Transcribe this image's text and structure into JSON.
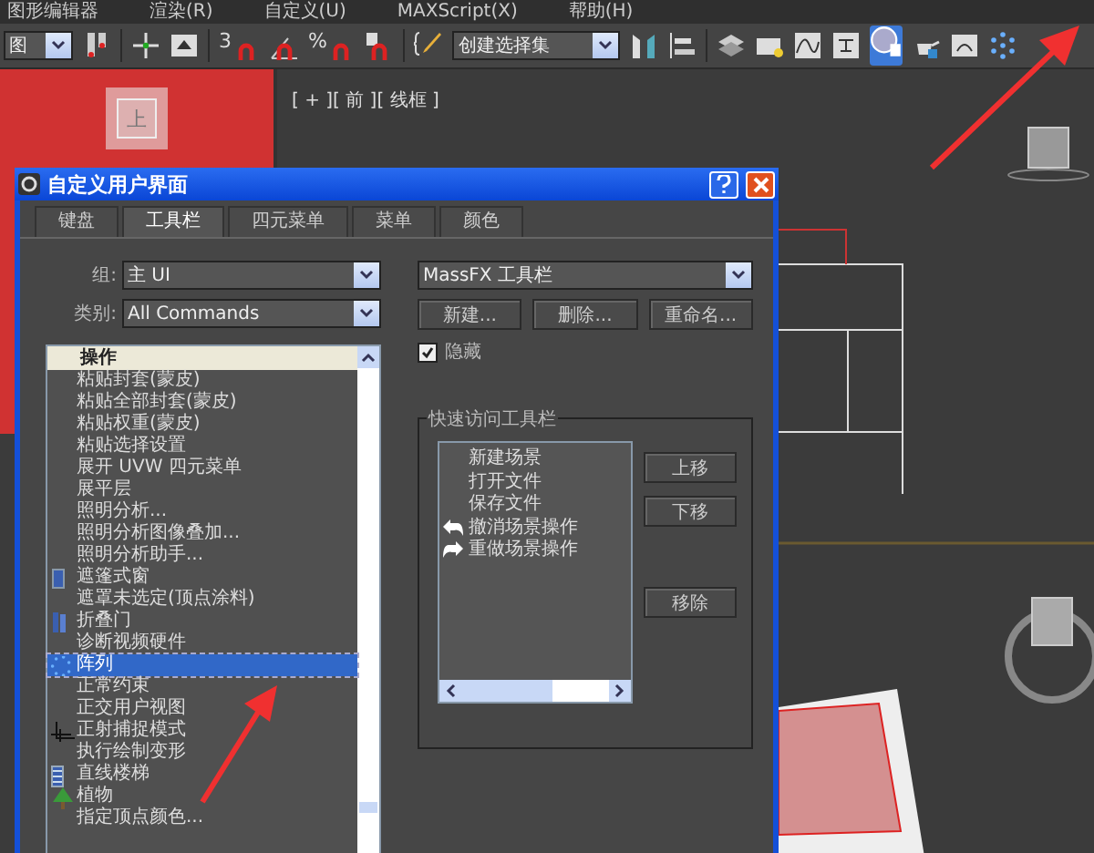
{
  "menu_bar": [
    "图形编辑器",
    "渲染(R)",
    "自定义(U)",
    "MAXScript(X)",
    "帮助(H)"
  ],
  "toolbar": {
    "layout_dropdown": "图",
    "snap_labels": [
      "3",
      "%"
    ],
    "selection_set_dropdown": "创建选择集"
  },
  "viewports": {
    "top_left_cube_label": "上",
    "front_label": "[ + ][ 前 ][ 线框 ]"
  },
  "dialog": {
    "title": "自定义用户界面",
    "tabs": [
      {
        "label": "键盘",
        "selected": false
      },
      {
        "label": "工具栏",
        "selected": true
      },
      {
        "label": "四元菜单",
        "selected": false
      },
      {
        "label": "菜单",
        "selected": false
      },
      {
        "label": "颜色",
        "selected": false
      }
    ],
    "group_label": "组:",
    "group_value": "主 UI",
    "category_label": "类别:",
    "category_value": "All Commands",
    "actions_header": "操作",
    "actions": [
      {
        "label": "粘贴封套(蒙皮)",
        "kind": "plain",
        "selected": false
      },
      {
        "label": "粘贴全部封套(蒙皮)",
        "kind": "plain",
        "selected": false
      },
      {
        "label": "粘贴权重(蒙皮)",
        "kind": "plain",
        "selected": false
      },
      {
        "label": "粘贴选择设置",
        "kind": "plain",
        "selected": false
      },
      {
        "label": "展开 UVW 四元菜单",
        "kind": "plain",
        "selected": false
      },
      {
        "label": "展平层",
        "kind": "plain",
        "selected": false
      },
      {
        "label": "照明分析...",
        "kind": "plain",
        "selected": false
      },
      {
        "label": "照明分析图像叠加...",
        "kind": "plain",
        "selected": false
      },
      {
        "label": "照明分析助手...",
        "kind": "plain",
        "selected": false
      },
      {
        "label": "遮篷式窗",
        "kind": "window",
        "selected": false
      },
      {
        "label": "遮罩未选定(顶点涂料)",
        "kind": "plain",
        "selected": false
      },
      {
        "label": "折叠门",
        "kind": "door",
        "selected": false
      },
      {
        "label": "诊断视频硬件",
        "kind": "plain",
        "selected": false
      },
      {
        "label": "阵列",
        "kind": "array",
        "selected": true
      },
      {
        "label": "正常约束",
        "kind": "plain",
        "selected": false
      },
      {
        "label": "正交用户视图",
        "kind": "plain",
        "selected": false
      },
      {
        "label": "正射捕捉模式",
        "kind": "snap",
        "selected": false
      },
      {
        "label": "执行绘制变形",
        "kind": "plain",
        "selected": false
      },
      {
        "label": "直线楼梯",
        "kind": "stairs",
        "selected": false
      },
      {
        "label": "植物",
        "kind": "plant",
        "selected": false
      },
      {
        "label": "指定顶点颜色...",
        "kind": "plain",
        "selected": false
      }
    ],
    "toolbar_value": "MassFX 工具栏",
    "toolbar_buttons": [
      "新建...",
      "删除...",
      "重命名..."
    ],
    "hide": {
      "label": "隐藏",
      "checked": true
    },
    "quick_access": {
      "title": "快速访问工具栏",
      "items": [
        {
          "label": "新建场景",
          "kind": "plain"
        },
        {
          "label": "打开文件",
          "kind": "plain"
        },
        {
          "label": "保存文件",
          "kind": "plain"
        },
        {
          "label": "撤消场景操作",
          "kind": "undo"
        },
        {
          "label": "重做场景操作",
          "kind": "redo"
        }
      ],
      "move_buttons": [
        "上移",
        "下移"
      ],
      "remove_button": "移除"
    }
  }
}
